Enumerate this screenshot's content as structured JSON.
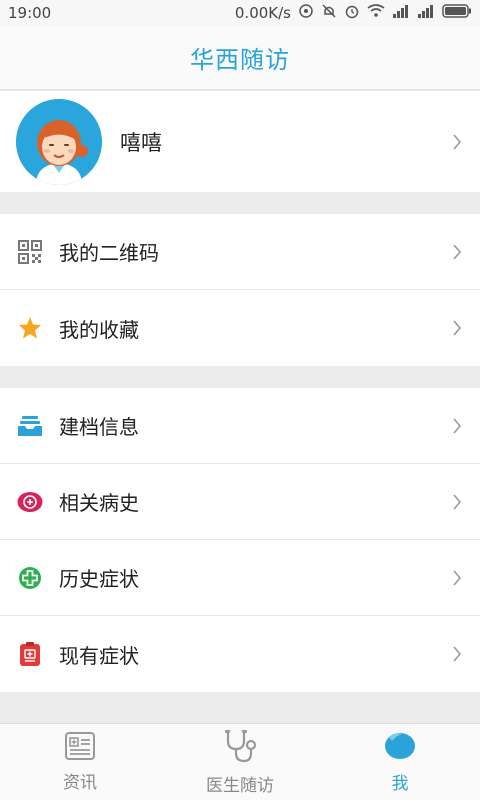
{
  "status_bar": {
    "time": "19:00",
    "net_speed": "0.00K/s"
  },
  "header": {
    "title": "华西随访"
  },
  "profile": {
    "name": "嘻嘻"
  },
  "menu_group_1": [
    {
      "label": "我的二维码",
      "icon": "qr-code-icon"
    },
    {
      "label": "我的收藏",
      "icon": "star-icon"
    }
  ],
  "menu_group_2": [
    {
      "label": "建档信息",
      "icon": "inbox-tray-icon"
    },
    {
      "label": "相关病史",
      "icon": "medical-history-icon"
    },
    {
      "label": "历史症状",
      "icon": "green-cross-icon"
    },
    {
      "label": "现有症状",
      "icon": "clipboard-icon"
    }
  ],
  "tabs": [
    {
      "label": "资讯",
      "icon": "news-icon",
      "active": false
    },
    {
      "label": "医生随访",
      "icon": "stethoscope-icon",
      "active": false
    },
    {
      "label": "我",
      "icon": "me-icon",
      "active": true
    }
  ],
  "colors": {
    "accent": "#2aa3d8",
    "star": "#f5a623",
    "history_red": "#d6245a",
    "green": "#2bb24c",
    "clipboard_red": "#e03c3c"
  }
}
